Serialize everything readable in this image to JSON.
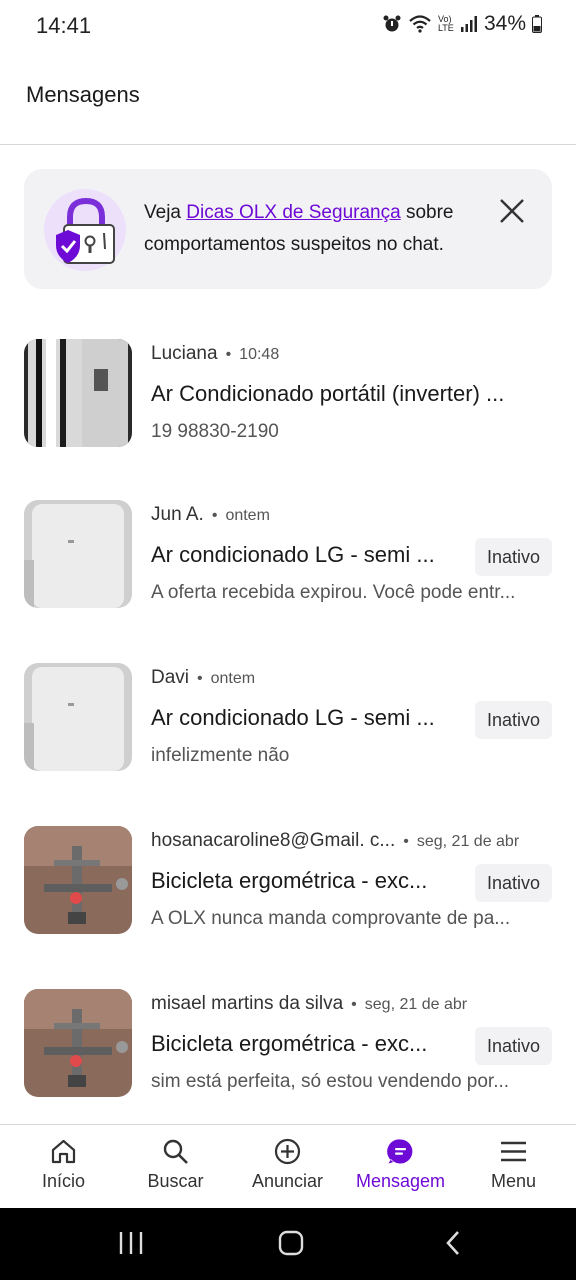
{
  "status": {
    "time": "14:41",
    "battery": "34%",
    "signal_text": "Vo) LTE"
  },
  "header": {
    "title": "Mensagens"
  },
  "banner": {
    "text_before": "Veja ",
    "link": "Dicas OLX de Segurança",
    "text_after": " sobre comportamentos suspeitos no chat."
  },
  "conversations": [
    {
      "sender": "Luciana",
      "time": "10:48",
      "title": "Ar Condicionado portátil (inverter) ...",
      "preview": "19 98830-2190",
      "badge": ""
    },
    {
      "sender": "Jun A.",
      "time": "ontem",
      "title": "Ar condicionado LG - semi ...",
      "preview": "A oferta recebida expirou. Você pode entr...",
      "badge": "Inativo"
    },
    {
      "sender": "Davi",
      "time": "ontem",
      "title": "Ar condicionado LG - semi ...",
      "preview": "infelizmente  não",
      "badge": "Inativo"
    },
    {
      "sender": "hosanacaroline8@Gmail. c...",
      "time": "seg, 21 de abr",
      "title": "Bicicleta ergométrica - exc...",
      "preview": "A OLX nunca manda comprovante de pa...",
      "badge": "Inativo"
    },
    {
      "sender": "misael martins da silva",
      "time": "seg, 21 de abr",
      "title": "Bicicleta ergométrica - exc...",
      "preview": "sim está perfeita, só  estou vendendo por...",
      "badge": "Inativo"
    }
  ],
  "nav": {
    "items": [
      {
        "label": "Início",
        "icon": "home-icon"
      },
      {
        "label": "Buscar",
        "icon": "search-icon"
      },
      {
        "label": "Anunciar",
        "icon": "plus-circle-icon"
      },
      {
        "label": "Mensagem",
        "icon": "chat-icon"
      },
      {
        "label": "Menu",
        "icon": "menu-icon"
      }
    ],
    "active_index": 3
  },
  "colors": {
    "brand_purple": "#6e0ad6",
    "banner_bg": "#f2f2f5",
    "badge_bg": "#f2f2f5"
  }
}
